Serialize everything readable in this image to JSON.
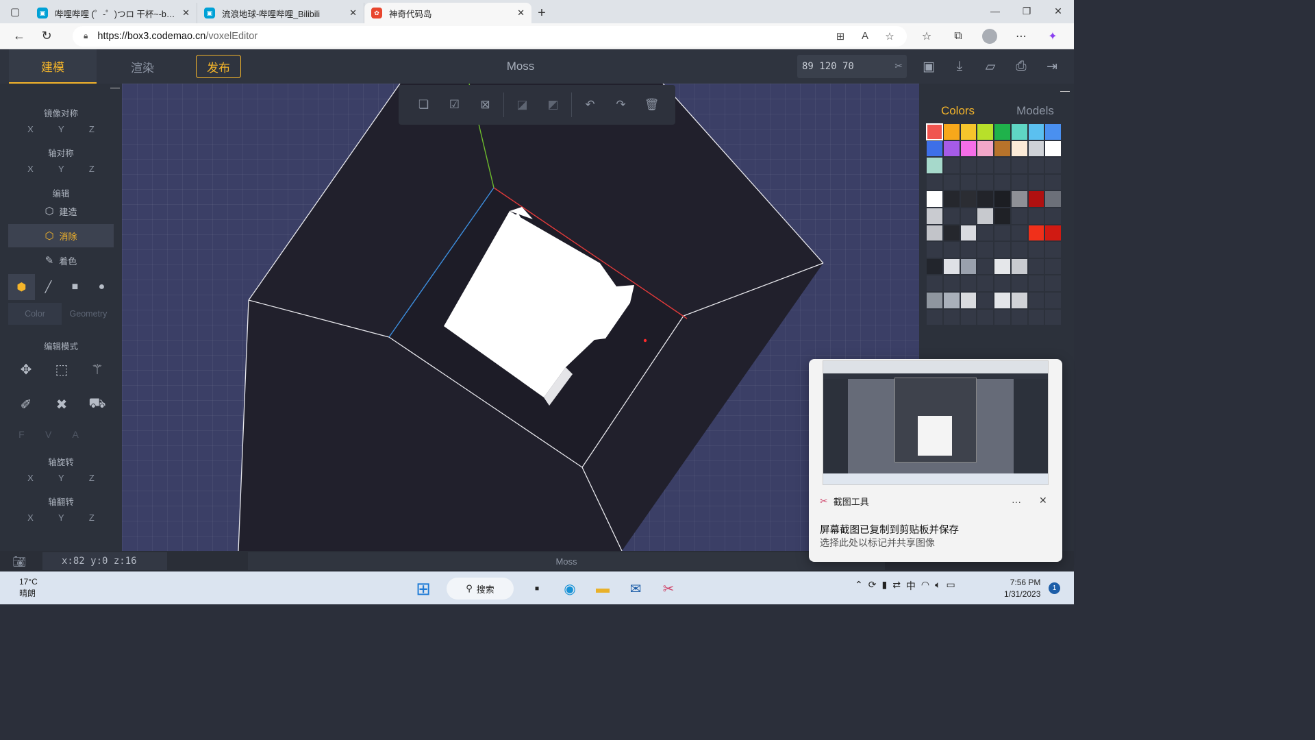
{
  "browser": {
    "tabs": [
      {
        "title": "哔哩哔哩 (゜-゜)つロ 干杯~-bilibili",
        "favicon_color": "#00a1d6",
        "active": false
      },
      {
        "title": "流浪地球-哔哩哔哩_Bilibili",
        "favicon_color": "#00a1d6",
        "active": false
      },
      {
        "title": "神奇代码岛",
        "favicon_color": "#e8462e",
        "active": true
      }
    ],
    "url_host": "https://box3.codemao.cn",
    "url_path": "/voxelEditor"
  },
  "app": {
    "mode_tabs": {
      "build": "建模",
      "render": "渲染"
    },
    "publish_label": "发布",
    "project_name": "Moss",
    "size_value": "89 120 70",
    "accent_color": "#f5b52a"
  },
  "left_panel": {
    "mirror": {
      "title": "镜像对称",
      "axes": [
        "X",
        "Y",
        "Z"
      ]
    },
    "axis_sym": {
      "title": "轴对称",
      "axes": [
        "X",
        "Y",
        "Z"
      ]
    },
    "edit": {
      "title": "编辑",
      "build": "建造",
      "erase": "消除",
      "paint": "着色"
    },
    "color_tab": "Color",
    "geometry_tab": "Geometry",
    "edit_mode_title": "编辑模式",
    "fva": [
      "F",
      "V",
      "A"
    ],
    "rotate": {
      "title": "轴旋转",
      "axes": [
        "X",
        "Y",
        "Z"
      ]
    },
    "flip": {
      "title": "轴翻转",
      "axes": [
        "X",
        "Y",
        "Z"
      ]
    }
  },
  "right_panel": {
    "tabs": {
      "colors": "Colors",
      "models": "Models"
    },
    "palette": [
      "#f0544f",
      "#f7a81b",
      "#f6c52c",
      "#b8e02a",
      "#1fb24b",
      "#5fd6c4",
      "#5bc0f0",
      "#4a90f0",
      "#3d6fe8",
      "#a65be8",
      "#f56ee8",
      "#f2a7c8",
      "#b7732b",
      "#fcebd8",
      "#cfd2d7",
      "#ffffff",
      "#a6d9cb",
      "",
      "",
      "",
      "",
      "",
      "",
      "",
      "",
      "",
      "",
      "",
      "",
      "",
      "",
      "",
      "#ffffff",
      "#25272d",
      "#2b2d33",
      "#22242a",
      "#1c1e23",
      "#8e9096",
      "#b01010",
      "#6c7079",
      "#c9cbd0",
      "",
      "",
      "#c7c9ce",
      "#1f2126",
      "",
      "",
      "",
      "#c2c4c9",
      "#25272d",
      "#d9dbe0",
      "",
      "",
      "",
      "#f0301a",
      "#d01a12",
      "",
      "",
      "",
      "",
      "",
      "",
      "",
      "",
      "#22252c",
      "#dfe1e6",
      "#9aa1ad",
      "",
      "#e5e7ea",
      "#c9cbd0",
      "",
      "",
      "",
      "",
      "",
      "",
      "",
      "",
      "",
      "",
      "#8f969f",
      "#a9b0ba",
      "#d9dbde",
      "",
      "#e3e5e8",
      "#d0d2d6",
      "",
      "",
      "",
      "",
      "",
      "",
      "",
      "",
      "",
      ""
    ]
  },
  "status": {
    "coords": "x:82 y:0 z:16",
    "name": "Moss"
  },
  "toast": {
    "app_name": "截图工具",
    "message": "屏幕截图已复制到剪贴板并保存",
    "sub_message": "选择此处以标记并共享图像"
  },
  "taskbar": {
    "temperature": "17°C",
    "weather": "晴朗",
    "search_label": "搜索",
    "ime": "中",
    "time": "7:56 PM",
    "date": "1/31/2023",
    "notification_count": "1"
  }
}
